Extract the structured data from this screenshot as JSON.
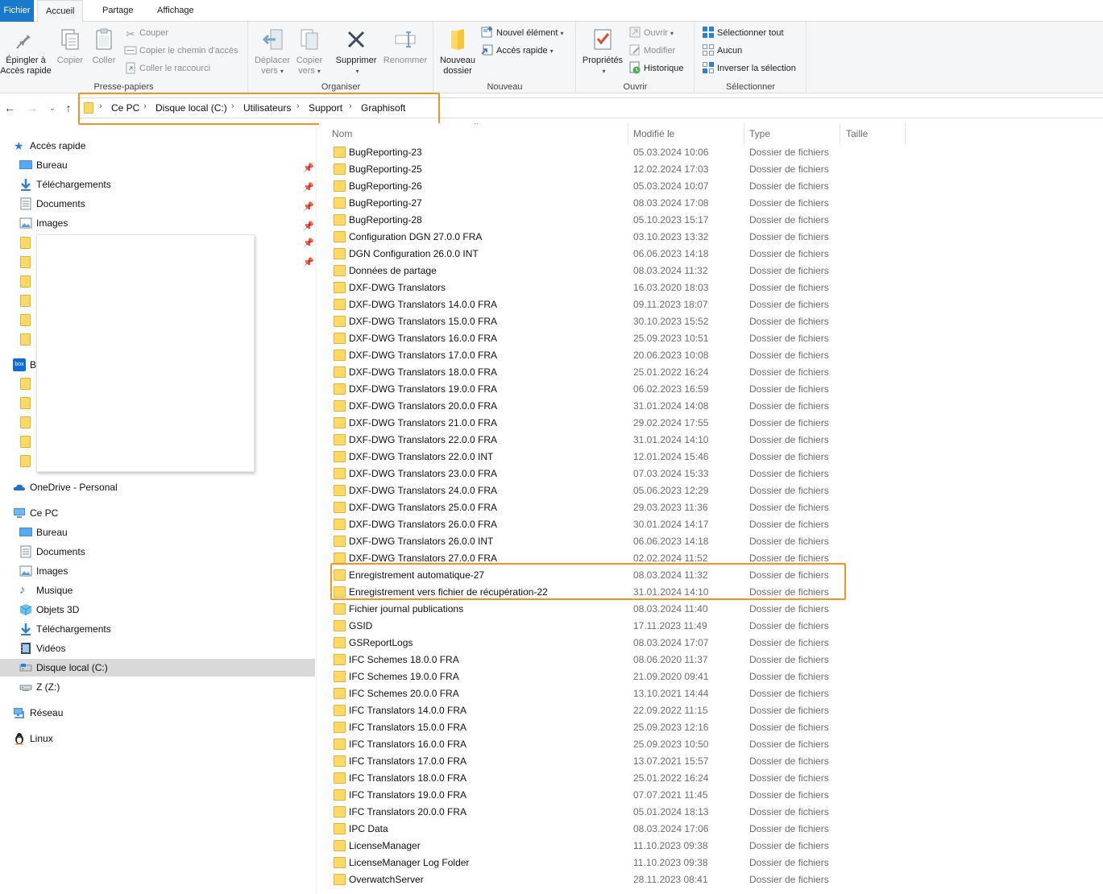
{
  "ribbon_tabs": [
    "Fichier",
    "Accueil",
    "Partage",
    "Affichage"
  ],
  "ribbon": {
    "clipboard": {
      "pin_label_1": "Épingler à",
      "pin_label_2": "Accès rapide",
      "copy": "Copier",
      "paste": "Coller",
      "cut": "Couper",
      "copy_path": "Copier le chemin d'accès",
      "paste_shortcut": "Coller le raccourci",
      "label": "Presse-papiers"
    },
    "organize": {
      "move_1": "Déplacer",
      "move_2": "vers",
      "copyto_1": "Copier",
      "copyto_2": "vers",
      "delete": "Supprimer",
      "rename": "Renommer",
      "label": "Organiser"
    },
    "new": {
      "new_folder_1": "Nouveau",
      "new_folder_2": "dossier",
      "new_item": "Nouvel élément",
      "quick_access": "Accès rapide",
      "label": "Nouveau"
    },
    "open": {
      "properties": "Propriétés",
      "open": "Ouvrir",
      "edit": "Modifier",
      "history": "Historique",
      "label": "Ouvrir"
    },
    "select": {
      "select_all": "Sélectionner tout",
      "select_none": "Aucun",
      "invert": "Inverser la sélection",
      "label": "Sélectionner"
    }
  },
  "breadcrumb": [
    "Ce PC",
    "Disque local (C:)",
    "Utilisateurs",
    "Support",
    "Graphisoft"
  ],
  "nav": {
    "quick_access": "Accès rapide",
    "quick_items": [
      {
        "label": "Bureau",
        "icon": "desktop-icon"
      },
      {
        "label": "Téléchargements",
        "icon": "downloads-icon"
      },
      {
        "label": "Documents",
        "icon": "documents-icon"
      },
      {
        "label": "Images",
        "icon": "images-icon"
      }
    ],
    "box_initial": "B",
    "onedrive": "OneDrive - Personal",
    "this_pc": "Ce PC",
    "pc_items": [
      {
        "label": "Bureau",
        "icon": "desktop-icon"
      },
      {
        "label": "Documents",
        "icon": "documents-icon"
      },
      {
        "label": "Images",
        "icon": "images-icon"
      },
      {
        "label": "Musique",
        "icon": "music-icon"
      },
      {
        "label": "Objets 3D",
        "icon": "3d-objects-icon"
      },
      {
        "label": "Téléchargements",
        "icon": "downloads-icon"
      },
      {
        "label": "Vidéos",
        "icon": "videos-icon"
      },
      {
        "label": "Disque local (C:)",
        "icon": "local-disk-icon"
      },
      {
        "label": "Z (Z:)",
        "icon": "network-drive-icon"
      }
    ],
    "network": "Réseau",
    "linux": "Linux"
  },
  "columns": {
    "name": "Nom",
    "modified": "Modifié le",
    "type": "Type",
    "size": "Taille"
  },
  "files": [
    {
      "name": "BugReporting-23",
      "date": "05.03.2024 10:06",
      "type": "Dossier de fichiers"
    },
    {
      "name": "BugReporting-25",
      "date": "12.02.2024 17:03",
      "type": "Dossier de fichiers"
    },
    {
      "name": "BugReporting-26",
      "date": "05.03.2024 10:07",
      "type": "Dossier de fichiers"
    },
    {
      "name": "BugReporting-27",
      "date": "08.03.2024 17:08",
      "type": "Dossier de fichiers"
    },
    {
      "name": "BugReporting-28",
      "date": "05.10.2023 15:17",
      "type": "Dossier de fichiers"
    },
    {
      "name": "Configuration DGN 27.0.0 FRA",
      "date": "03.10.2023 13:32",
      "type": "Dossier de fichiers"
    },
    {
      "name": "DGN Configuration 26.0.0 INT",
      "date": "06.06.2023 14:18",
      "type": "Dossier de fichiers"
    },
    {
      "name": "Données de partage",
      "date": "08.03.2024 11:32",
      "type": "Dossier de fichiers"
    },
    {
      "name": "DXF-DWG Translators",
      "date": "16.03.2020 18:03",
      "type": "Dossier de fichiers"
    },
    {
      "name": "DXF-DWG Translators 14.0.0 FRA",
      "date": "09.11.2023 18:07",
      "type": "Dossier de fichiers"
    },
    {
      "name": "DXF-DWG Translators 15.0.0 FRA",
      "date": "30.10.2023 15:52",
      "type": "Dossier de fichiers"
    },
    {
      "name": "DXF-DWG Translators 16.0.0 FRA",
      "date": "25.09.2023 10:51",
      "type": "Dossier de fichiers"
    },
    {
      "name": "DXF-DWG Translators 17.0.0 FRA",
      "date": "20.06.2023 10:08",
      "type": "Dossier de fichiers"
    },
    {
      "name": "DXF-DWG Translators 18.0.0 FRA",
      "date": "25.01.2022 16:24",
      "type": "Dossier de fichiers"
    },
    {
      "name": "DXF-DWG Translators 19.0.0 FRA",
      "date": "06.02.2023 16:59",
      "type": "Dossier de fichiers"
    },
    {
      "name": "DXF-DWG Translators 20.0.0 FRA",
      "date": "31.01.2024 14:08",
      "type": "Dossier de fichiers"
    },
    {
      "name": "DXF-DWG Translators 21.0.0 FRA",
      "date": "29.02.2024 17:55",
      "type": "Dossier de fichiers"
    },
    {
      "name": "DXF-DWG Translators 22.0.0 FRA",
      "date": "31.01.2024 14:10",
      "type": "Dossier de fichiers"
    },
    {
      "name": "DXF-DWG Translators 22.0.0 INT",
      "date": "12.01.2024 15:46",
      "type": "Dossier de fichiers"
    },
    {
      "name": "DXF-DWG Translators 23.0.0 FRA",
      "date": "07.03.2024 15:33",
      "type": "Dossier de fichiers"
    },
    {
      "name": "DXF-DWG Translators 24.0.0 FRA",
      "date": "05.06.2023 12:29",
      "type": "Dossier de fichiers"
    },
    {
      "name": "DXF-DWG Translators 25.0.0 FRA",
      "date": "29.03.2023 11:36",
      "type": "Dossier de fichiers"
    },
    {
      "name": "DXF-DWG Translators 26.0.0 FRA",
      "date": "30.01.2024 14:17",
      "type": "Dossier de fichiers"
    },
    {
      "name": "DXF-DWG Translators 26.0.0 INT",
      "date": "06.06.2023 14:18",
      "type": "Dossier de fichiers"
    },
    {
      "name": "DXF-DWG Translators 27.0.0 FRA",
      "date": "02.02.2024 11:52",
      "type": "Dossier de fichiers"
    },
    {
      "name": "Enregistrement automatique-27",
      "date": "08.03.2024 11:32",
      "type": "Dossier de fichiers"
    },
    {
      "name": "Enregistrement vers fichier de récupération-22",
      "date": "31.01.2024 14:10",
      "type": "Dossier de fichiers"
    },
    {
      "name": "Fichier journal publications",
      "date": "08.03.2024 11:40",
      "type": "Dossier de fichiers"
    },
    {
      "name": "GSID",
      "date": "17.11.2023 11:49",
      "type": "Dossier de fichiers"
    },
    {
      "name": "GSReportLogs",
      "date": "08.03.2024 17:07",
      "type": "Dossier de fichiers"
    },
    {
      "name": "IFC Schemes 18.0.0 FRA",
      "date": "08.06.2020 11:37",
      "type": "Dossier de fichiers"
    },
    {
      "name": "IFC Schemes 19.0.0 FRA",
      "date": "21.09.2020 09:41",
      "type": "Dossier de fichiers"
    },
    {
      "name": "IFC Schemes 20.0.0 FRA",
      "date": "13.10.2021 14:44",
      "type": "Dossier de fichiers"
    },
    {
      "name": "IFC Translators 14.0.0 FRA",
      "date": "22.09.2022 11:15",
      "type": "Dossier de fichiers"
    },
    {
      "name": "IFC Translators 15.0.0 FRA",
      "date": "25.09.2023 12:16",
      "type": "Dossier de fichiers"
    },
    {
      "name": "IFC Translators 16.0.0 FRA",
      "date": "25.09.2023 10:50",
      "type": "Dossier de fichiers"
    },
    {
      "name": "IFC Translators 17.0.0 FRA",
      "date": "13.07.2021 15:57",
      "type": "Dossier de fichiers"
    },
    {
      "name": "IFC Translators 18.0.0 FRA",
      "date": "25.01.2022 16:24",
      "type": "Dossier de fichiers"
    },
    {
      "name": "IFC Translators 19.0.0 FRA",
      "date": "07.07.2021 11:45",
      "type": "Dossier de fichiers"
    },
    {
      "name": "IFC Translators 20.0.0 FRA",
      "date": "05.01.2024 18:13",
      "type": "Dossier de fichiers"
    },
    {
      "name": "IPC Data",
      "date": "08.03.2024 17:06",
      "type": "Dossier de fichiers"
    },
    {
      "name": "LicenseManager",
      "date": "11.10.2023 09:38",
      "type": "Dossier de fichiers"
    },
    {
      "name": "LicenseManager Log Folder",
      "date": "11.10.2023 09:38",
      "type": "Dossier de fichiers"
    },
    {
      "name": "OverwatchServer",
      "date": "28.11.2023 08:41",
      "type": "Dossier de fichiers"
    }
  ],
  "colors": {
    "accent": "#1979ca",
    "highlight": "#f7931e",
    "folder": "#ffd966",
    "selected": "#d9d9d9"
  }
}
